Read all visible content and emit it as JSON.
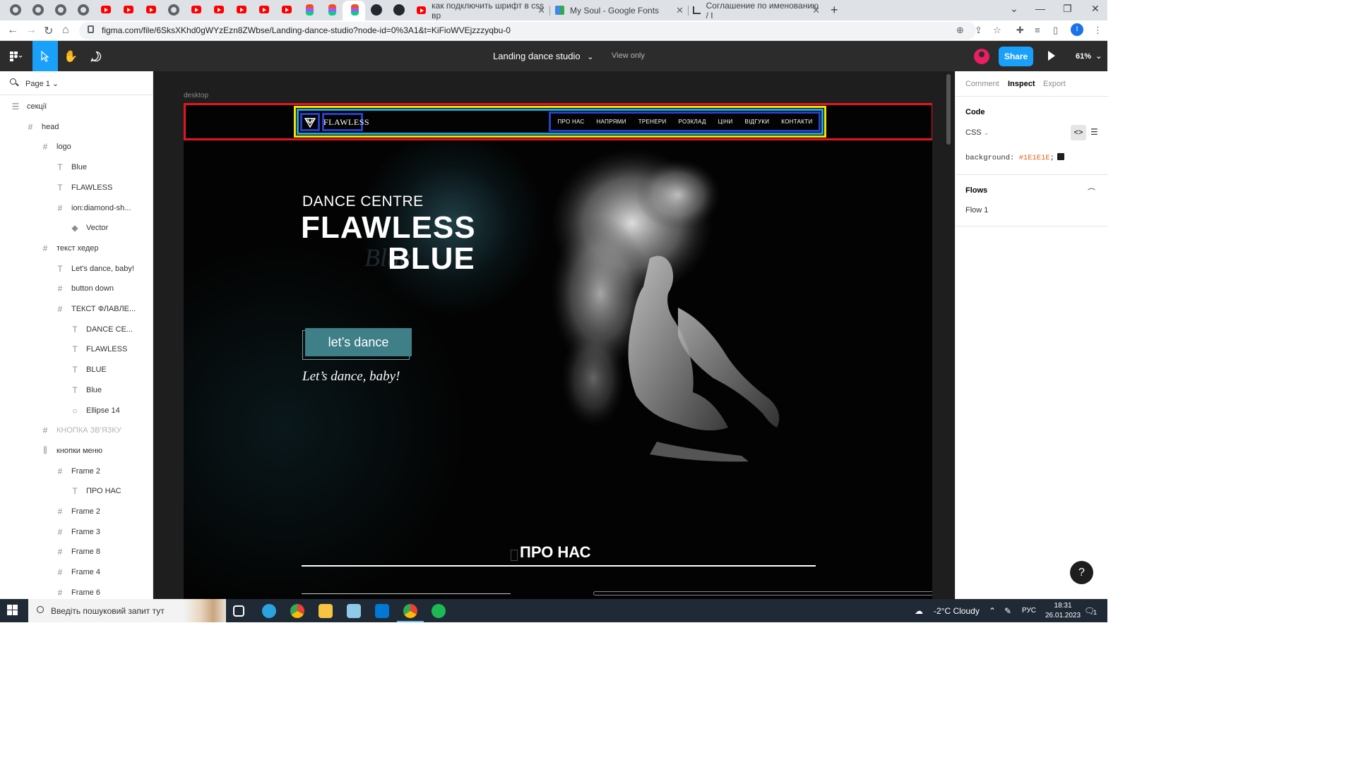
{
  "browser": {
    "tabs": [
      {
        "title": "как подключить шрифт в css вр"
      },
      {
        "title": "My Soul - Google Fonts"
      },
      {
        "title": "Соглашение по именованию / I"
      }
    ],
    "url": "figma.com/file/6SksXKhd0gWYzEzn8ZWbse/Landing-dance-studio?node-id=0%3A1&t=KiFioWVEjzzzyqbu-0",
    "profile_initial": "I"
  },
  "figma": {
    "doc_title": "Landing dance studio",
    "doc_title_chevron": "⌄",
    "view_only": "View only",
    "share": "Share",
    "zoom": "61%",
    "page": "Page 1",
    "frame_label": "desktop"
  },
  "layers": [
    {
      "name": "секції",
      "icon": "frame-stack",
      "indent": 1
    },
    {
      "name": "head",
      "icon": "hash",
      "indent": 2
    },
    {
      "name": "logo",
      "icon": "hash",
      "indent": 3
    },
    {
      "name": "Blue",
      "icon": "text",
      "indent": 4
    },
    {
      "name": "FLAWLESS",
      "icon": "text",
      "indent": 4
    },
    {
      "name": "ion:diamond-sh...",
      "icon": "hash",
      "indent": 4
    },
    {
      "name": "Vector",
      "icon": "vector",
      "indent": 5
    },
    {
      "name": "текст хедер",
      "icon": "hash",
      "indent": 3
    },
    {
      "name": "Let's dance, baby!",
      "icon": "text",
      "indent": 4
    },
    {
      "name": "button down",
      "icon": "hash",
      "indent": 4
    },
    {
      "name": "ТЕКСТ ФЛАВЛЕ...",
      "icon": "hash",
      "indent": 4
    },
    {
      "name": "DANCE CE...",
      "icon": "text",
      "indent": 5
    },
    {
      "name": "FLAWLESS",
      "icon": "text",
      "indent": 5
    },
    {
      "name": "BLUE",
      "icon": "text",
      "indent": 5
    },
    {
      "name": "Blue",
      "icon": "text",
      "indent": 5
    },
    {
      "name": "Ellipse 14",
      "icon": "ellipse",
      "indent": 5
    },
    {
      "name": "КНОПКА ЗВ'ЯЗКУ",
      "icon": "hash",
      "indent": 3,
      "dim": true
    },
    {
      "name": "кнопки меню",
      "icon": "columns",
      "indent": 3
    },
    {
      "name": "Frame 2",
      "icon": "hash",
      "indent": 4
    },
    {
      "name": "ПРО НАС",
      "icon": "text",
      "indent": 5
    },
    {
      "name": "Frame 2",
      "icon": "hash",
      "indent": 4
    },
    {
      "name": "Frame 3",
      "icon": "hash",
      "indent": 4
    },
    {
      "name": "Frame 8",
      "icon": "hash",
      "indent": 4
    },
    {
      "name": "Frame 4",
      "icon": "hash",
      "indent": 4
    },
    {
      "name": "Frame 6",
      "icon": "hash",
      "indent": 4
    }
  ],
  "site": {
    "logo_text": "FLAWLESS",
    "nav": [
      "ПРО НАС",
      "НАПРЯМИ",
      "ТРЕНЕРИ",
      "РОЗКЛАД",
      "ЦІНИ",
      "ВІДГУКИ",
      "КОНТАКТИ"
    ],
    "hero_small": "DANCE CENTRE",
    "hero_big1": "FLAWLESS",
    "hero_big2": "BLUE",
    "hero_script": "Blue",
    "button": "let’s dance",
    "tagline": "Let’s dance, baby!",
    "about_title": "ПРО НАС"
  },
  "inspect": {
    "tabs": [
      "Comment",
      "Inspect",
      "Export"
    ],
    "code_title": "Code",
    "lang": "CSS",
    "code_prop": "background: ",
    "code_value": "#1E1E1E",
    "code_end": ";",
    "flows_title": "Flows",
    "flow_item": "Flow 1",
    "help": "?"
  },
  "taskbar": {
    "search_placeholder": "Введіть пошуковий запит тут",
    "weather": "-2°C  Cloudy",
    "lang": "РУС",
    "time": "18:31",
    "date": "26.01.2023",
    "notif_count": "1"
  },
  "colors": {
    "figma_accent": "#18a0fb",
    "selection_red": "#e3161f",
    "selection_yellow": "#f5e000",
    "selection_cyan": "#19a7e0",
    "selection_blue": "#2a3fc1",
    "button_teal": "#3f7f87"
  }
}
